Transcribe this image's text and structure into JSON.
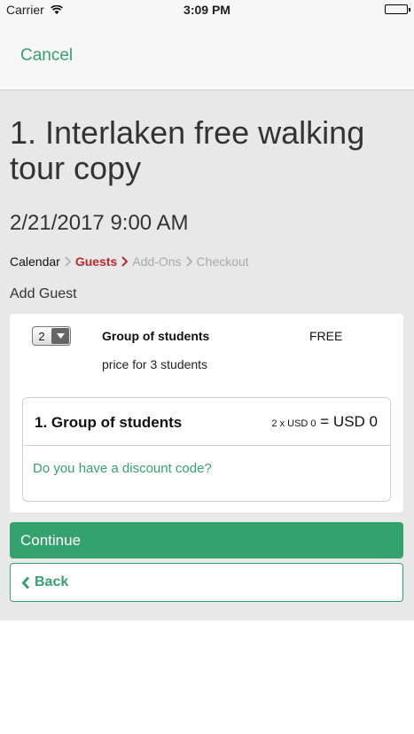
{
  "status_bar": {
    "carrier": "Carrier",
    "time": "3:09 PM"
  },
  "nav": {
    "cancel_label": "Cancel"
  },
  "tour": {
    "title": "1. Interlaken free walking tour copy",
    "datetime": "2/21/2017 9:00 AM"
  },
  "breadcrumb": {
    "steps": [
      {
        "label": "Calendar",
        "state": "done"
      },
      {
        "label": "Guests",
        "state": "current"
      },
      {
        "label": "Add-Ons",
        "state": "upcoming"
      },
      {
        "label": "Checkout",
        "state": "upcoming"
      }
    ]
  },
  "add_guest": {
    "label": "Add Guest"
  },
  "ticket": {
    "quantity": "2",
    "name": "Group of students",
    "price": "FREE",
    "description": "price for 3 students"
  },
  "summary": {
    "label": "1. Group of students",
    "calc_small": "2 x USD 0",
    "calc_equals": " = USD 0",
    "discount_prompt": "Do you have a discount code?"
  },
  "actions": {
    "continue_label": "Continue",
    "back_label": "Back"
  },
  "colors": {
    "accent": "#35a16f",
    "current_step": "#c0282d",
    "page_bg": "#e8e8e8"
  },
  "icons": {
    "wifi": "wifi-icon",
    "battery": "battery-icon",
    "chevron": "chevron-right-icon",
    "caret": "caret-down-icon",
    "back": "chevron-left-icon"
  }
}
